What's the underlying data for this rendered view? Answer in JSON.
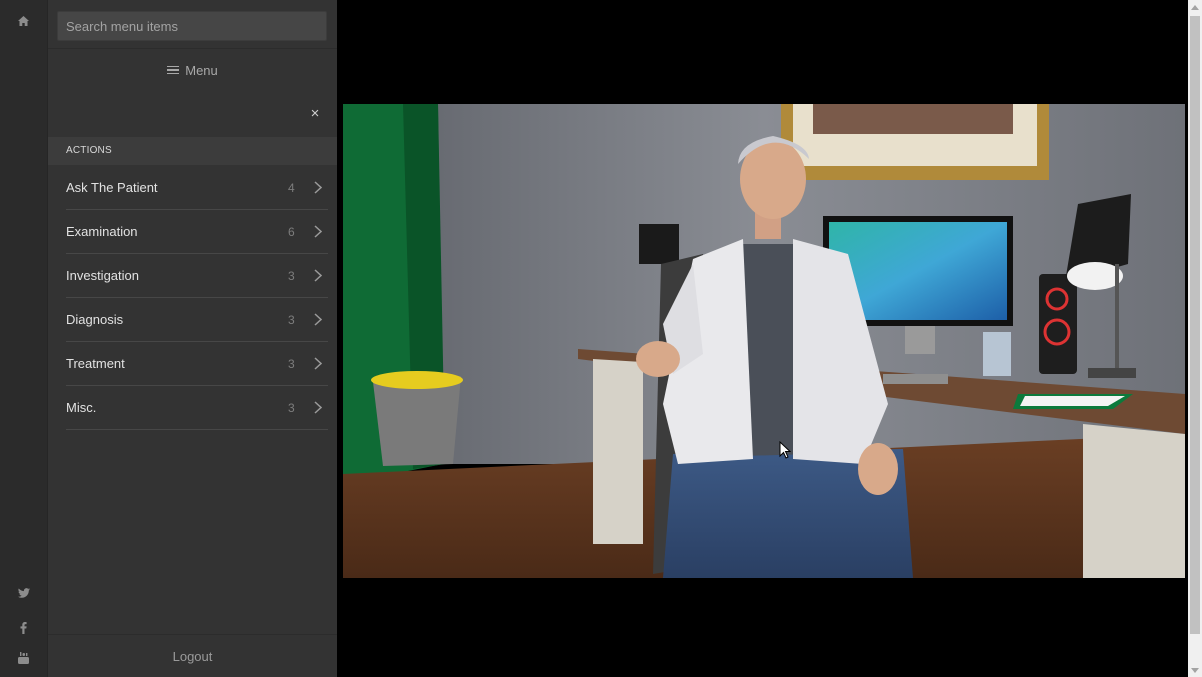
{
  "rail": {
    "icons": [
      "home-icon",
      "twitter-icon",
      "facebook-icon",
      "youtube-icon"
    ]
  },
  "sidebar": {
    "search_placeholder": "Search menu items",
    "menu_label": "Menu",
    "close_glyph": "×",
    "section_title": "ACTIONS",
    "items": [
      {
        "label": "Ask The Patient",
        "count": "4"
      },
      {
        "label": "Examination",
        "count": "6"
      },
      {
        "label": "Investigation",
        "count": "3"
      },
      {
        "label": "Diagnosis",
        "count": "3"
      },
      {
        "label": "Treatment",
        "count": "3"
      },
      {
        "label": "Misc.",
        "count": "3"
      }
    ],
    "logout_label": "Logout"
  },
  "colors": {
    "rail_bg": "#2b2b2b",
    "panel_bg": "#333333",
    "section_bg": "#3c3c3c",
    "chevron": "#9a9a9a"
  }
}
